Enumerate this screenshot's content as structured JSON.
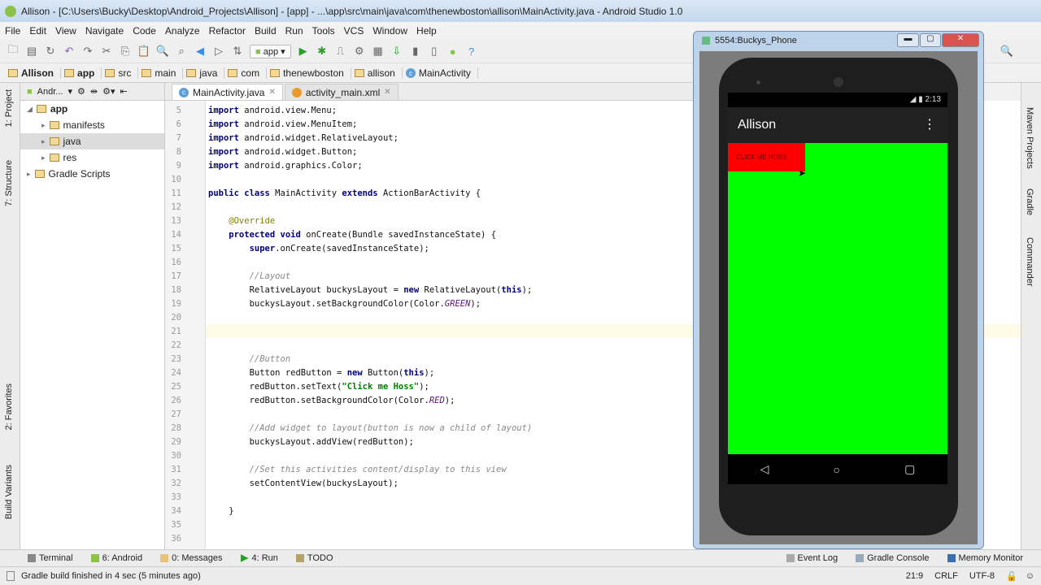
{
  "window": {
    "title": "Allison - [C:\\Users\\Bucky\\Desktop\\Android_Projects\\Allison] - [app] - ...\\app\\src\\main\\java\\com\\thenewboston\\allison\\MainActivity.java - Android Studio 1.0"
  },
  "menu": [
    "File",
    "Edit",
    "View",
    "Navigate",
    "Code",
    "Analyze",
    "Refactor",
    "Build",
    "Run",
    "Tools",
    "VCS",
    "Window",
    "Help"
  ],
  "toolbar": {
    "run_config": "app"
  },
  "breadcrumb": [
    "Allison",
    "app",
    "src",
    "main",
    "java",
    "com",
    "thenewboston",
    "allison",
    "MainActivity"
  ],
  "project_panel": {
    "view": "Andr...",
    "tree": [
      {
        "label": "app",
        "depth": 0
      },
      {
        "label": "manifests",
        "depth": 1
      },
      {
        "label": "java",
        "depth": 1,
        "selected": true
      },
      {
        "label": "res",
        "depth": 1
      },
      {
        "label": "Gradle Scripts",
        "depth": 0
      }
    ]
  },
  "left_strip": [
    "1: Project",
    "7: Structure",
    "2: Favorites",
    "Build Variants"
  ],
  "right_strip": [
    "Maven Projects",
    "Gradle",
    "Commander"
  ],
  "tabs": [
    {
      "label": "MainActivity.java",
      "active": true
    },
    {
      "label": "activity_main.xml",
      "active": false
    }
  ],
  "editor": {
    "current_line": 21,
    "lines": [
      {
        "n": 5,
        "t": [
          [
            "import",
            "kw"
          ],
          [
            " android.view.Menu;",
            ""
          ]
        ]
      },
      {
        "n": 6,
        "t": [
          [
            "import",
            "kw"
          ],
          [
            " android.view.MenuItem;",
            ""
          ]
        ]
      },
      {
        "n": 7,
        "t": [
          [
            "import",
            "kw"
          ],
          [
            " android.widget.RelativeLayout;",
            ""
          ]
        ]
      },
      {
        "n": 8,
        "t": [
          [
            "import",
            "kw"
          ],
          [
            " android.widget.Button;",
            ""
          ]
        ]
      },
      {
        "n": 9,
        "t": [
          [
            "import",
            "kw"
          ],
          [
            " android.graphics.Color;",
            ""
          ]
        ]
      },
      {
        "n": 10,
        "t": []
      },
      {
        "n": 11,
        "t": [
          [
            "public class",
            "kw"
          ],
          [
            " MainActivity ",
            ""
          ],
          [
            "extends",
            "kw"
          ],
          [
            " ActionBarActivity {",
            ""
          ]
        ]
      },
      {
        "n": 12,
        "t": []
      },
      {
        "n": 13,
        "t": [
          [
            "    @Override",
            "an"
          ]
        ]
      },
      {
        "n": 14,
        "t": [
          [
            "    protected void",
            "kw"
          ],
          [
            " onCreate(Bundle savedInstanceState) {",
            ""
          ]
        ]
      },
      {
        "n": 15,
        "t": [
          [
            "        super",
            "kw"
          ],
          [
            ".onCreate(savedInstanceState);",
            ""
          ]
        ]
      },
      {
        "n": 16,
        "t": []
      },
      {
        "n": 17,
        "t": [
          [
            "        //Layout",
            "cm"
          ]
        ]
      },
      {
        "n": 18,
        "t": [
          [
            "        RelativeLayout buckysLayout = ",
            ""
          ],
          [
            "new",
            "kw"
          ],
          [
            " RelativeLayout(",
            ""
          ],
          [
            "this",
            "kw"
          ],
          [
            ");",
            ""
          ]
        ]
      },
      {
        "n": 19,
        "t": [
          [
            "        buckysLayout.setBackgroundColor(Color.",
            ""
          ],
          [
            "GREEN",
            "fd"
          ],
          [
            ");",
            ""
          ]
        ]
      },
      {
        "n": 20,
        "t": []
      },
      {
        "n": 21,
        "t": []
      },
      {
        "n": 22,
        "t": []
      },
      {
        "n": 23,
        "t": [
          [
            "        //Button",
            "cm"
          ]
        ]
      },
      {
        "n": 24,
        "t": [
          [
            "        Button redButton = ",
            ""
          ],
          [
            "new",
            "kw"
          ],
          [
            " Button(",
            ""
          ],
          [
            "this",
            "kw"
          ],
          [
            ");",
            ""
          ]
        ]
      },
      {
        "n": 25,
        "t": [
          [
            "        redButton.setText(",
            ""
          ],
          [
            "\"Click me Hoss\"",
            "st"
          ],
          [
            ");",
            ""
          ]
        ]
      },
      {
        "n": 26,
        "t": [
          [
            "        redButton.setBackgroundColor(Color.",
            ""
          ],
          [
            "RED",
            "fd"
          ],
          [
            ");",
            ""
          ]
        ]
      },
      {
        "n": 27,
        "t": []
      },
      {
        "n": 28,
        "t": [
          [
            "        //Add widget to layout(button is now a child of layout)",
            "cm"
          ]
        ]
      },
      {
        "n": 29,
        "t": [
          [
            "        buckysLayout.addView(redButton);",
            ""
          ]
        ]
      },
      {
        "n": 30,
        "t": []
      },
      {
        "n": 31,
        "t": [
          [
            "        //Set this activities content/display to this view",
            "cm"
          ]
        ]
      },
      {
        "n": 32,
        "t": [
          [
            "        setContentView(buckysLayout);",
            ""
          ]
        ]
      },
      {
        "n": 33,
        "t": []
      },
      {
        "n": 34,
        "t": [
          [
            "    }",
            ""
          ]
        ]
      },
      {
        "n": 35,
        "t": []
      },
      {
        "n": 36,
        "t": []
      }
    ]
  },
  "bottom_tools": {
    "left": [
      "Terminal",
      "6: Android",
      "0: Messages",
      "4: Run",
      "TODO"
    ],
    "right": [
      "Event Log",
      "Gradle Console",
      "Memory Monitor"
    ]
  },
  "status": {
    "message": "Gradle build finished in 4 sec (5 minutes ago)",
    "position": "21:9",
    "line_sep": "CRLF",
    "encoding": "UTF-8"
  },
  "emulator": {
    "title": "5554:Buckys_Phone",
    "time": "2:13",
    "app_title": "Allison",
    "button_text": "CLICK ME HOSS",
    "screen_bg": "#00ff00",
    "button_bg": "#ff0000"
  }
}
